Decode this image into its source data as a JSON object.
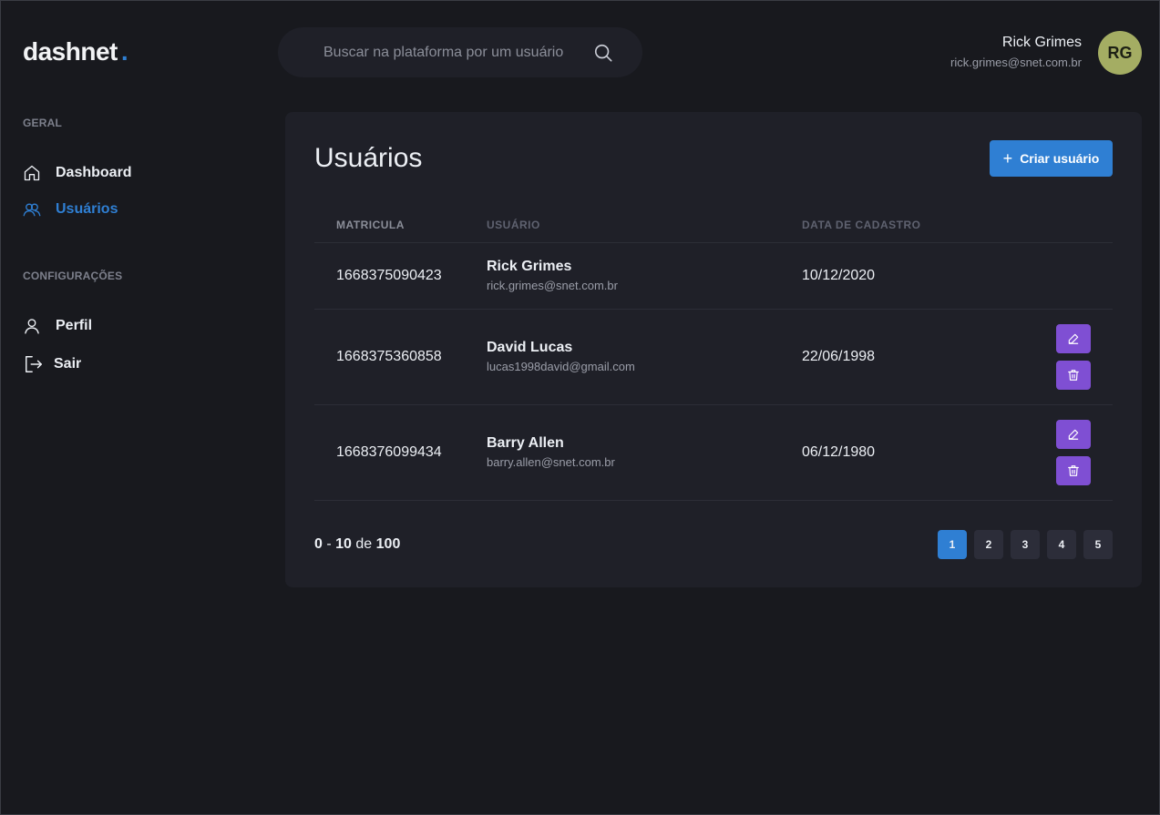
{
  "brand": {
    "name": "dashnet",
    "dot": ".",
    "accent": "#2f7fd3"
  },
  "search": {
    "placeholder": "Buscar na plataforma por um usuário",
    "icon": "search-icon"
  },
  "user": {
    "name": "Rick Grimes",
    "email": "rick.grimes@snet.com.br",
    "initials": "RG",
    "avatar_color": "#a4ad63"
  },
  "sidebar": {
    "sections": [
      {
        "title": "GERAL",
        "items": [
          {
            "label": "Dashboard",
            "icon": "home-icon",
            "active": false
          },
          {
            "label": "Usuários",
            "icon": "users-icon",
            "active": true
          }
        ]
      },
      {
        "title": "CONFIGURAÇÕES",
        "items": [
          {
            "label": "Perfil",
            "icon": "user-icon",
            "active": false
          },
          {
            "label": "Sair",
            "icon": "logout-icon",
            "active": false
          }
        ]
      }
    ]
  },
  "main": {
    "title": "Usuários",
    "create_button": {
      "label": "Criar usuário",
      "icon": "plus-icon",
      "color": "#2f7fd3"
    },
    "table": {
      "columns": [
        "MATRICULA",
        "USUÁRIO",
        "DATA DE CADASTRO"
      ],
      "rows": [
        {
          "matricula": "1668375090423",
          "name": "Rick Grimes",
          "email": "rick.grimes@snet.com.br",
          "date": "10/12/2020",
          "actions": false
        },
        {
          "matricula": "1668375360858",
          "name": "David Lucas",
          "email": "lucas1998david@gmail.com",
          "date": "22/06/1998",
          "actions": true
        },
        {
          "matricula": "1668376099434",
          "name": "Barry Allen",
          "email": "barry.allen@snet.com.br",
          "date": "06/12/1980",
          "actions": true
        }
      ],
      "action_color": "#7f4fd3"
    },
    "pagination": {
      "range_start": "0",
      "range_end": "10",
      "of_label": "de",
      "total": "100",
      "pages": [
        "1",
        "2",
        "3",
        "4",
        "5"
      ],
      "current": "1"
    }
  }
}
